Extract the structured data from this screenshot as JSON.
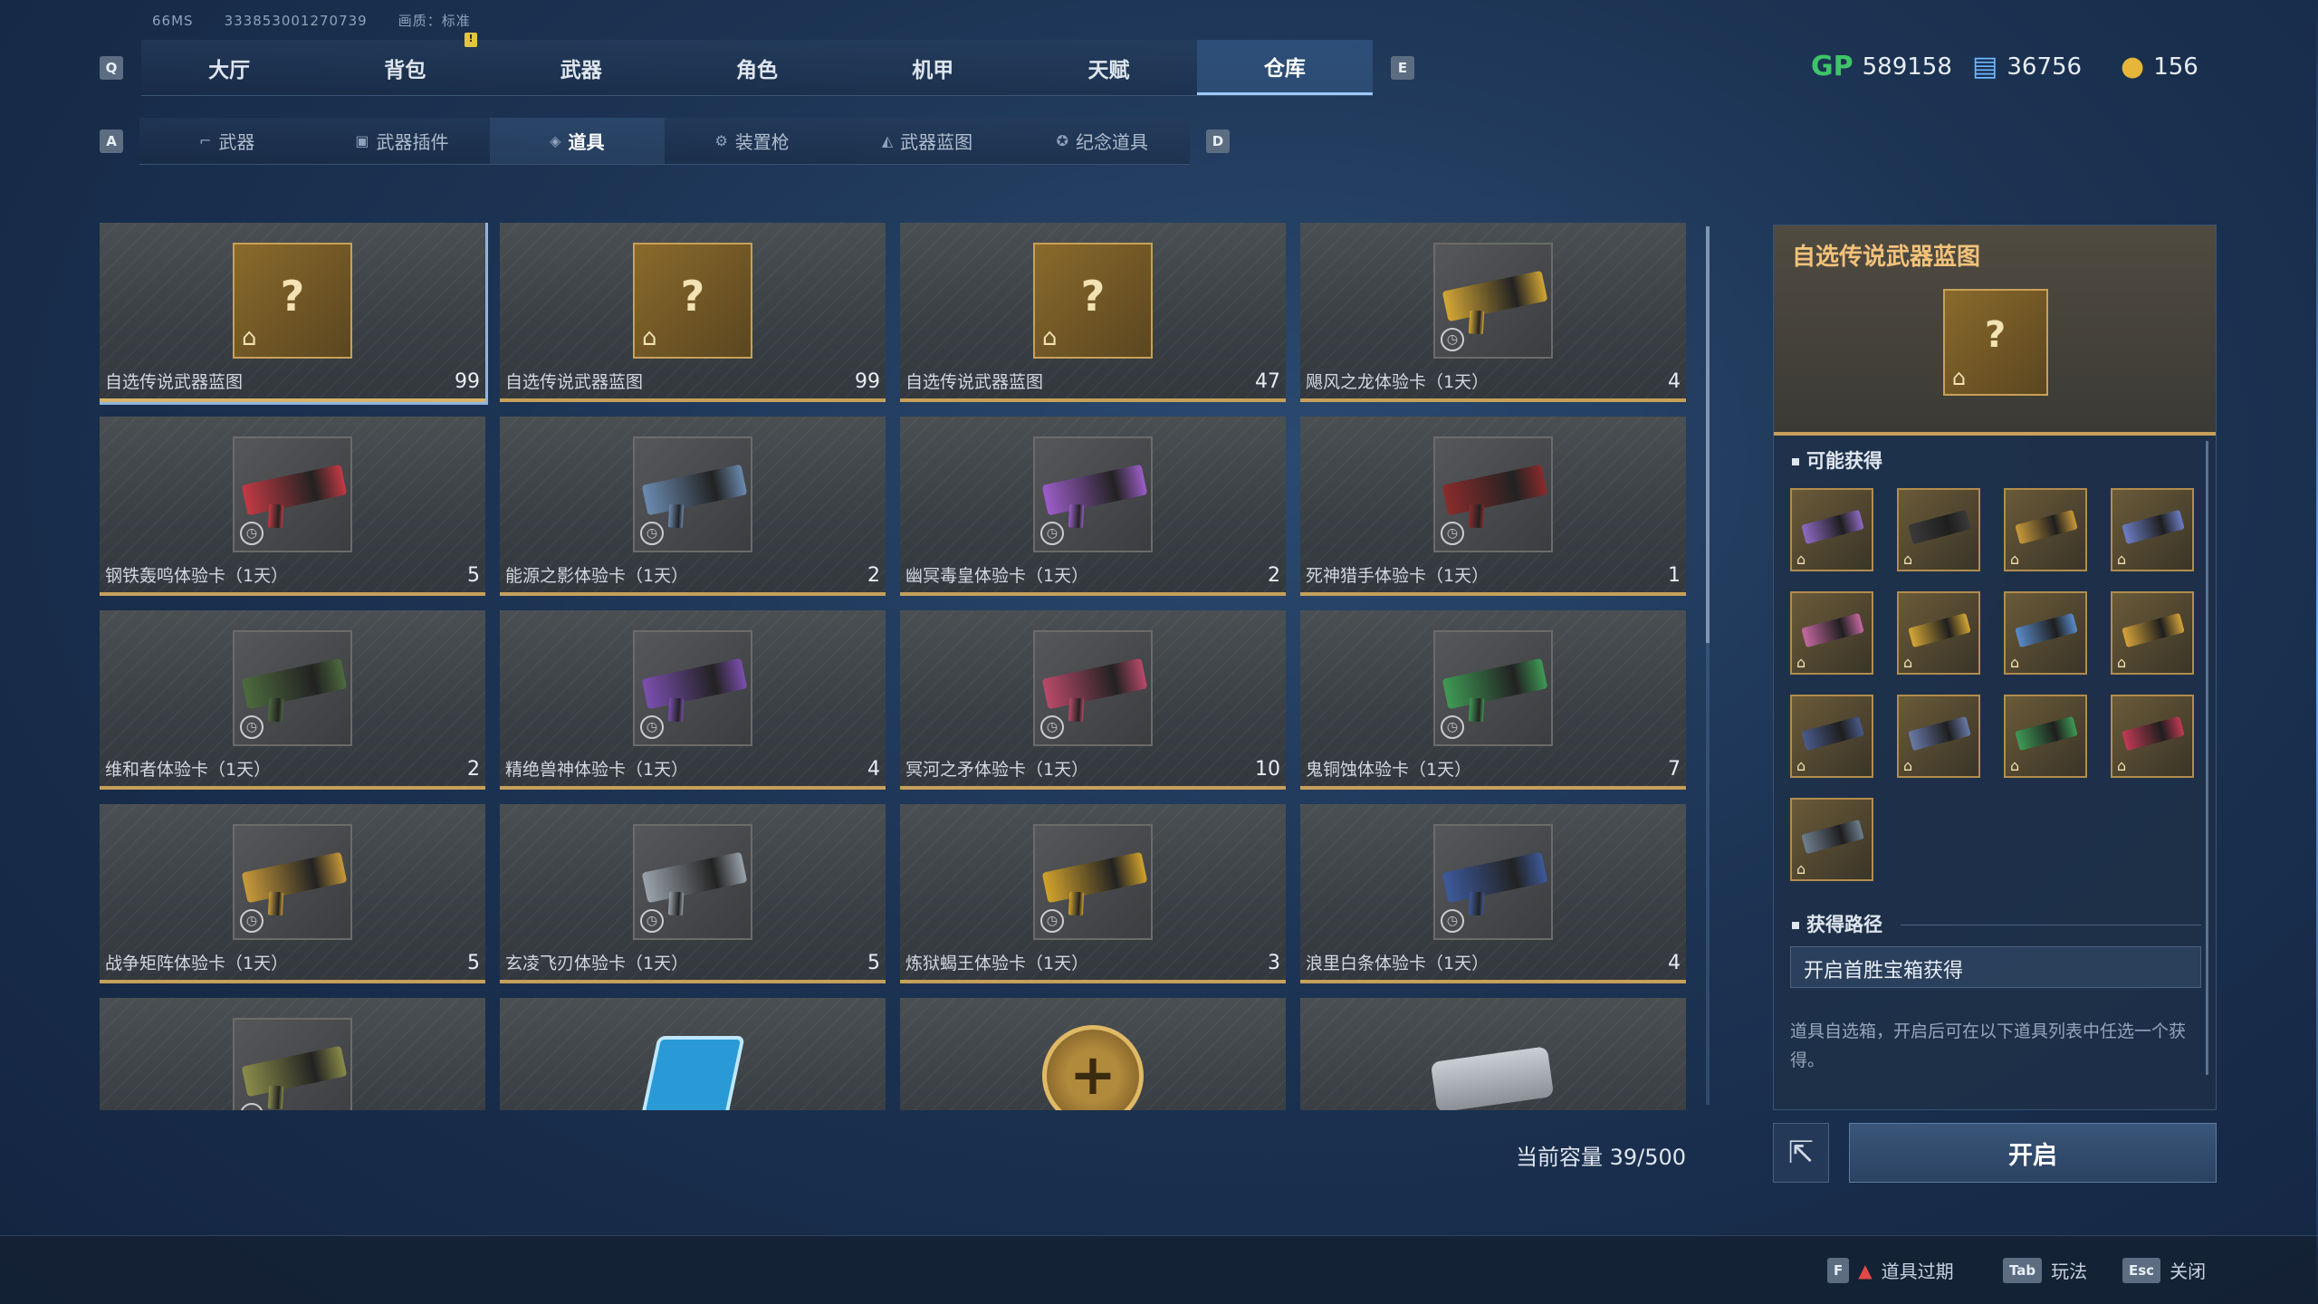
{
  "topinfo": {
    "build": "66MS",
    "uid": "333853001270739",
    "quality": "画质：标准"
  },
  "keys": {
    "main_prev": "Q",
    "main_next": "E",
    "sub_prev": "A",
    "sub_next": "D"
  },
  "main_tabs": [
    {
      "label": "大厅"
    },
    {
      "label": "背包"
    },
    {
      "label": "武器"
    },
    {
      "label": "角色"
    },
    {
      "label": "机甲"
    },
    {
      "label": "天赋"
    },
    {
      "label": "仓库",
      "active": true
    }
  ],
  "notif_badge": "!",
  "currency": {
    "gp": {
      "icon": "GP",
      "value": "589158"
    },
    "ticket": {
      "icon": "ticket-icon",
      "value": "36756"
    },
    "coin": {
      "icon": "coin-icon",
      "value": "156"
    }
  },
  "sub_tabs": [
    {
      "label": "武器",
      "icon": "rifle-icon"
    },
    {
      "label": "武器插件",
      "icon": "plugin-icon"
    },
    {
      "label": "道具",
      "icon": "tag-icon",
      "active": true
    },
    {
      "label": "装置枪",
      "icon": "turret-icon"
    },
    {
      "label": "武器蓝图",
      "icon": "blueprint-icon"
    },
    {
      "label": "纪念道具",
      "icon": "medal-icon"
    }
  ],
  "items": [
    {
      "name": "自选传说武器蓝图",
      "count": "99",
      "type": "blueprint"
    },
    {
      "name": "自选传说武器蓝图",
      "count": "99",
      "type": "blueprint"
    },
    {
      "name": "自选传说武器蓝图",
      "count": "47",
      "type": "blueprint"
    },
    {
      "name": "飓风之龙体验卡（1天）",
      "count": "4",
      "type": "trial",
      "color": "#d4a735"
    },
    {
      "name": "钢铁轰鸣体验卡（1天）",
      "count": "5",
      "type": "trial",
      "color": "#c23a44"
    },
    {
      "name": "能源之影体验卡（1天）",
      "count": "2",
      "type": "trial",
      "color": "#6b8bb0"
    },
    {
      "name": "幽冥毒皇体验卡（1天）",
      "count": "2",
      "type": "trial",
      "color": "#9c5ec8"
    },
    {
      "name": "死神猎手体验卡（1天）",
      "count": "1",
      "type": "trial",
      "color": "#8a2b2b"
    },
    {
      "name": "维和者体验卡（1天）",
      "count": "2",
      "type": "trial",
      "color": "#4d6a3e"
    },
    {
      "name": "精绝兽神体验卡（1天）",
      "count": "4",
      "type": "trial",
      "color": "#7b4fb0"
    },
    {
      "name": "冥河之矛体验卡（1天）",
      "count": "10",
      "type": "trial",
      "color": "#b94a6a"
    },
    {
      "name": "鬼铜蚀体验卡（1天）",
      "count": "7",
      "type": "trial",
      "color": "#3f9a55"
    },
    {
      "name": "战争矩阵体验卡（1天）",
      "count": "5",
      "type": "trial",
      "color": "#c99a3b"
    },
    {
      "name": "玄凌飞刃体验卡（1天）",
      "count": "5",
      "type": "trial",
      "color": "#9aa3ad"
    },
    {
      "name": "炼狱蝎王体验卡（1天）",
      "count": "3",
      "type": "trial",
      "color": "#d2a32c"
    },
    {
      "name": "浪里白条体验卡（1天）",
      "count": "4",
      "type": "trial",
      "color": "#3d5a9c"
    },
    {
      "name": "",
      "count": "",
      "type": "trial",
      "color": "#8a8d4a"
    },
    {
      "name": "",
      "count": "",
      "type": "chip",
      "color": "#2a9ad6"
    },
    {
      "name": "",
      "count": "",
      "type": "coin",
      "color": "#b18a3c"
    },
    {
      "name": "",
      "count": "",
      "type": "case",
      "color": "#c8ced4"
    }
  ],
  "capacity": "当前容量 39/500",
  "detail": {
    "title": "自选传说武器蓝图",
    "possible_label": "可能获得",
    "rewards": [
      {
        "color": "#8f6ac4"
      },
      {
        "color": "#3a3a3a"
      },
      {
        "color": "#c99a3b"
      },
      {
        "color": "#6d7ec4"
      },
      {
        "color": "#c56aa0"
      },
      {
        "color": "#d4a735"
      },
      {
        "color": "#5b8bc8"
      },
      {
        "color": "#d6a43a"
      },
      {
        "color": "#4a5a8a"
      },
      {
        "color": "#6a7aa8"
      },
      {
        "color": "#3f9a55"
      },
      {
        "color": "#c23a54"
      },
      {
        "color": "#6f7f8f"
      }
    ],
    "route_label": "获得路径",
    "route": "开启首胜宝箱获得",
    "desc": "道具自选箱，开启后可在以下道具列表中任选一个获得。"
  },
  "buttons": {
    "open": "开启",
    "share_icon": "share-icon"
  },
  "footer": [
    {
      "key": "F",
      "label": "道具过期",
      "warn": "▲"
    },
    {
      "key": "Tab",
      "label": "玩法"
    },
    {
      "key": "Esc",
      "label": "关闭"
    }
  ]
}
